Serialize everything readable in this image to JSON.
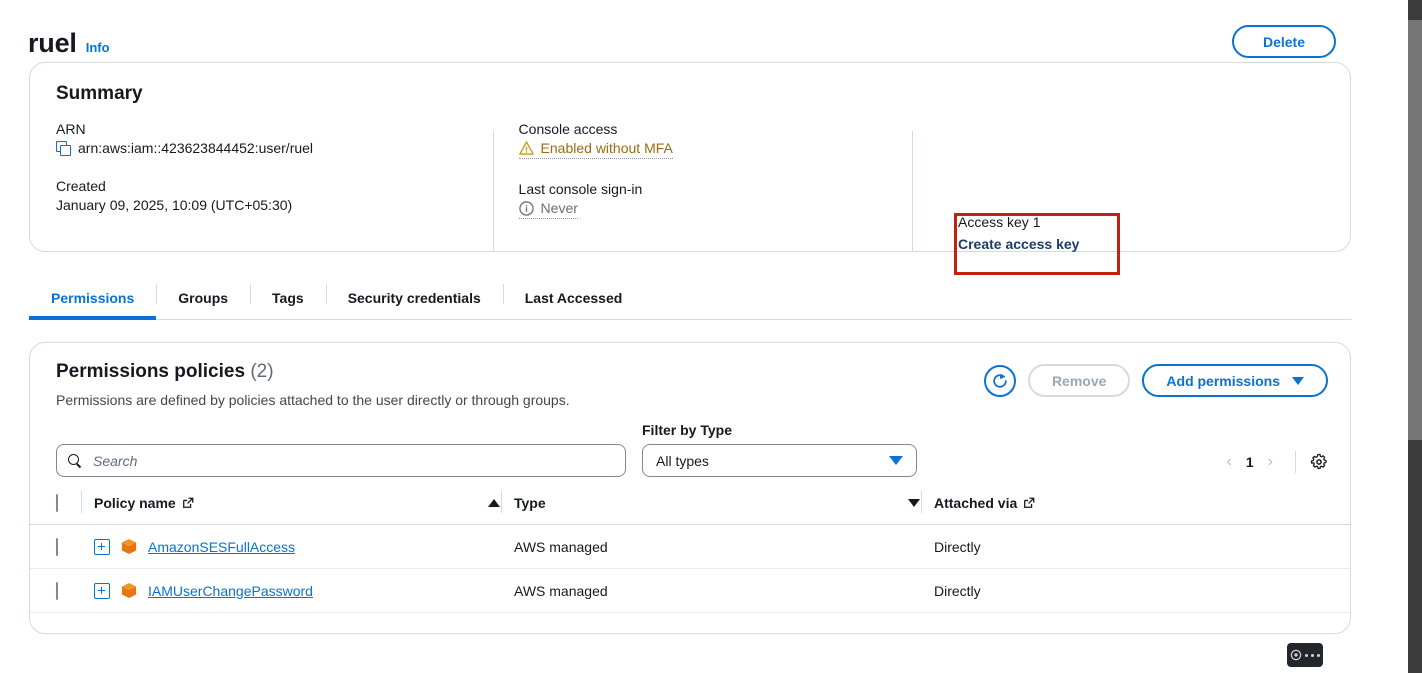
{
  "header": {
    "title": "ruel",
    "info_label": "Info",
    "delete_label": "Delete"
  },
  "summary": {
    "title": "Summary",
    "arn_label": "ARN",
    "arn_value": "arn:aws:iam::423623844452:user/ruel",
    "created_label": "Created",
    "created_value": "January 09, 2025, 10:09 (UTC+05:30)",
    "console_access_label": "Console access",
    "console_access_value": "Enabled without MFA",
    "last_signin_label": "Last console sign-in",
    "last_signin_value": "Never",
    "access_key_label": "Access key 1",
    "access_key_link": "Create access key",
    "highlight_color": "#c0220f"
  },
  "tabs": [
    {
      "label": "Permissions",
      "active": true
    },
    {
      "label": "Groups",
      "active": false
    },
    {
      "label": "Tags",
      "active": false
    },
    {
      "label": "Security credentials",
      "active": false
    },
    {
      "label": "Last Accessed",
      "active": false
    }
  ],
  "policies": {
    "title": "Permissions policies",
    "count": "(2)",
    "description": "Permissions are defined by policies attached to the user directly or through groups.",
    "remove_label": "Remove",
    "add_permissions_label": "Add permissions",
    "search_placeholder": "Search",
    "search_value": "",
    "filter_label": "Filter by Type",
    "filter_value": "All types",
    "page_number": "1",
    "columns": {
      "policy_name": "Policy name",
      "type": "Type",
      "attached_via": "Attached via"
    },
    "rows": [
      {
        "name": "AmazonSESFullAccess",
        "type": "AWS managed",
        "attached_via": "Directly"
      },
      {
        "name": "IAMUserChangePassword",
        "type": "AWS managed",
        "attached_via": "Directly"
      }
    ]
  },
  "colors": {
    "accent": "#0972d3",
    "warning": "#9c6b12",
    "policy_icon": "#ec7211"
  }
}
